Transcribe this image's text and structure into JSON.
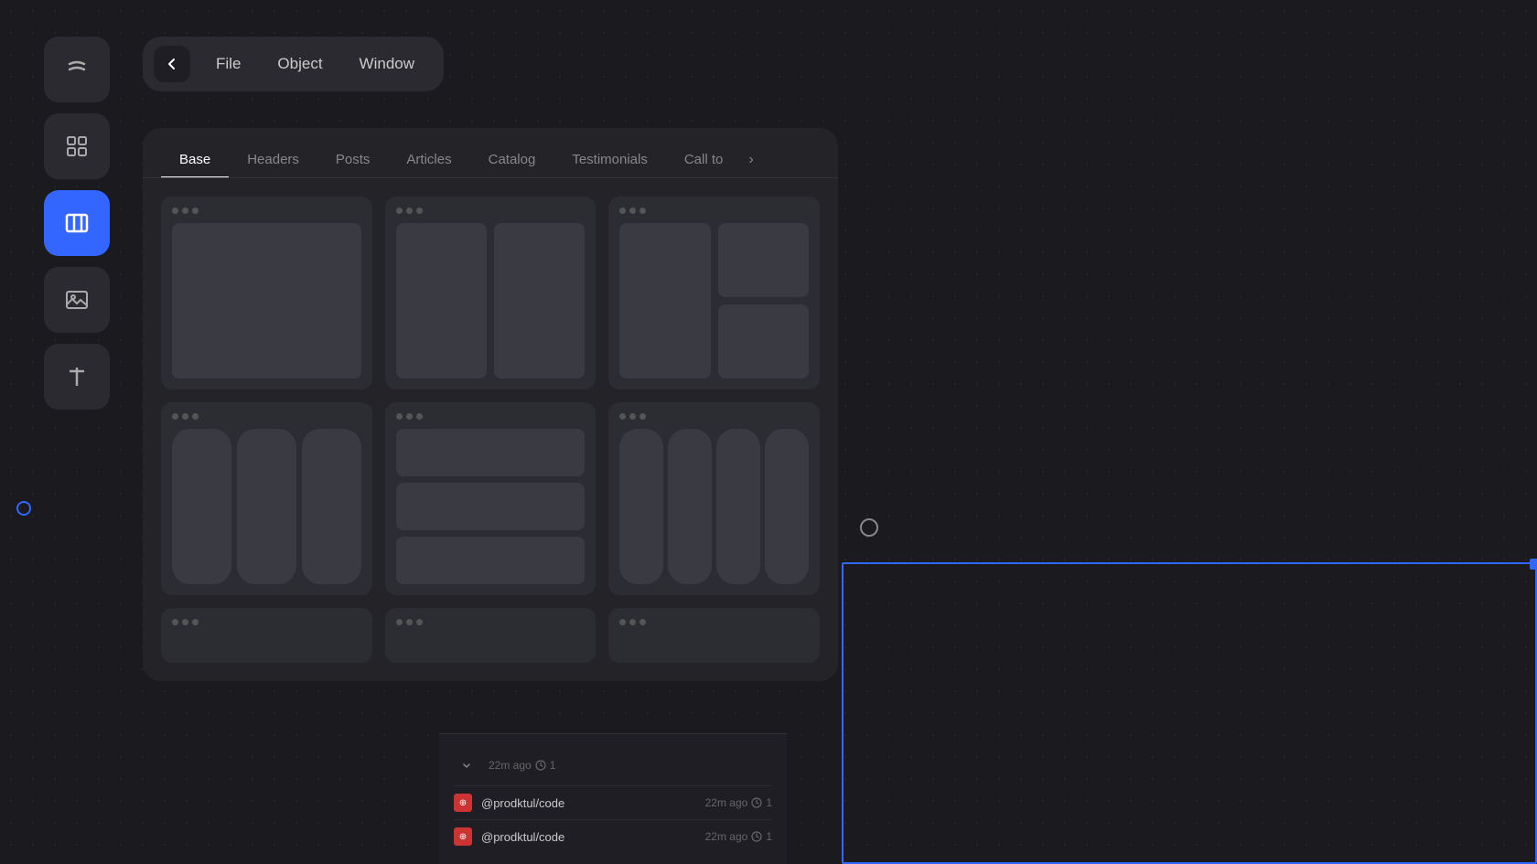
{
  "app": {
    "logo_icon": "curve-icon",
    "background_dot_color": "#2a2a30"
  },
  "menu": {
    "back_label": "‹",
    "items": [
      {
        "label": "File",
        "id": "file"
      },
      {
        "label": "Object",
        "id": "object"
      },
      {
        "label": "Window",
        "id": "window"
      }
    ]
  },
  "sidebar": {
    "buttons": [
      {
        "id": "logo",
        "icon": "logo-icon",
        "active": false
      },
      {
        "id": "components",
        "icon": "grid-icon",
        "active": false
      },
      {
        "id": "sections",
        "icon": "columns-icon",
        "active": true
      },
      {
        "id": "media",
        "icon": "image-icon",
        "active": false
      },
      {
        "id": "text",
        "icon": "text-icon",
        "active": false
      }
    ]
  },
  "tabs": {
    "items": [
      {
        "label": "Base",
        "active": true
      },
      {
        "label": "Headers",
        "active": false
      },
      {
        "label": "Posts",
        "active": false
      },
      {
        "label": "Articles",
        "active": false
      },
      {
        "label": "Catalog",
        "active": false
      },
      {
        "label": "Testimonials",
        "active": false
      },
      {
        "label": "Call to",
        "active": false
      }
    ]
  },
  "templates": [
    {
      "id": "t1",
      "layout": "single"
    },
    {
      "id": "t2",
      "layout": "two-col"
    },
    {
      "id": "t3",
      "layout": "right-stacked"
    },
    {
      "id": "t4",
      "layout": "three-col"
    },
    {
      "id": "t5",
      "layout": "left-stacked-3"
    },
    {
      "id": "t6",
      "layout": "four-col"
    },
    {
      "id": "t7",
      "layout": "three-col"
    }
  ],
  "bottom_panel": {
    "rows": [
      {
        "time": "22m ago",
        "count": "1",
        "repo": "@prodktul/code",
        "repo_letter": "p"
      },
      {
        "time": "22m ago",
        "count": "1",
        "repo": "@prodktul/code",
        "repo_letter": "p"
      }
    ]
  }
}
